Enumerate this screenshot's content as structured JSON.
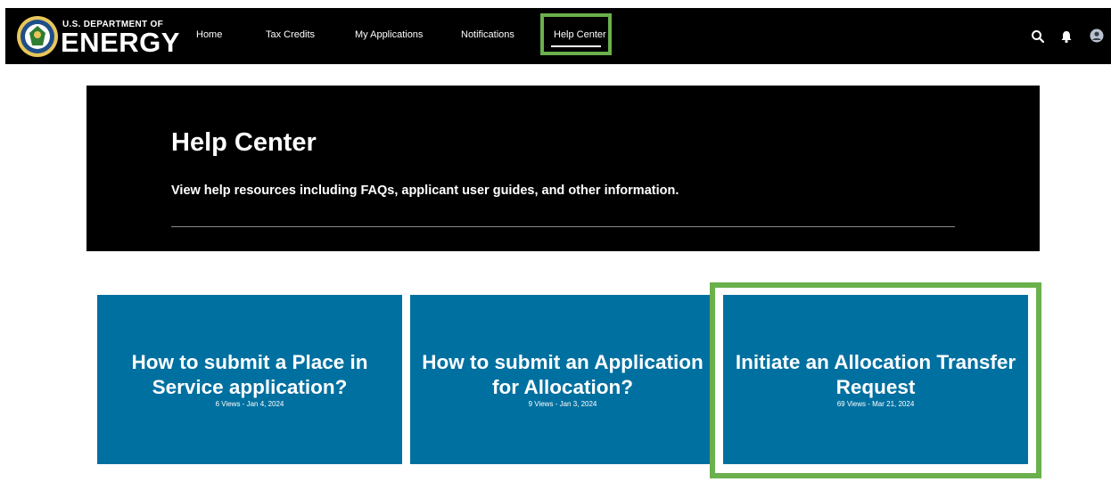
{
  "header": {
    "logo": {
      "top_text": "U.S. DEPARTMENT OF",
      "main_text": "ENERGY"
    },
    "nav": [
      {
        "label": "Home"
      },
      {
        "label": "Tax Credits"
      },
      {
        "label": "My Applications"
      },
      {
        "label": "Notifications"
      },
      {
        "label": "Help Center",
        "active": true
      }
    ],
    "icons": [
      "search-icon",
      "bell-icon",
      "user-avatar-icon"
    ]
  },
  "hero": {
    "title": "Help Center",
    "subtitle": "View help resources including FAQs, applicant user guides, and other information."
  },
  "cards": [
    {
      "title": "How to submit a Place in Service application?",
      "meta": "6 Views - Jan 4, 2024"
    },
    {
      "title": "How to submit an Application for Allocation?",
      "meta": "9 Views - Jan 3, 2024"
    },
    {
      "title": "Initiate an Allocation Transfer Request",
      "meta": "69 Views - Mar 21, 2024",
      "highlighted": true
    }
  ],
  "colors": {
    "nav_bg": "#000000",
    "hero_bg": "#000000",
    "card_bg": "#0070a0",
    "highlight": "#6ab04c"
  }
}
